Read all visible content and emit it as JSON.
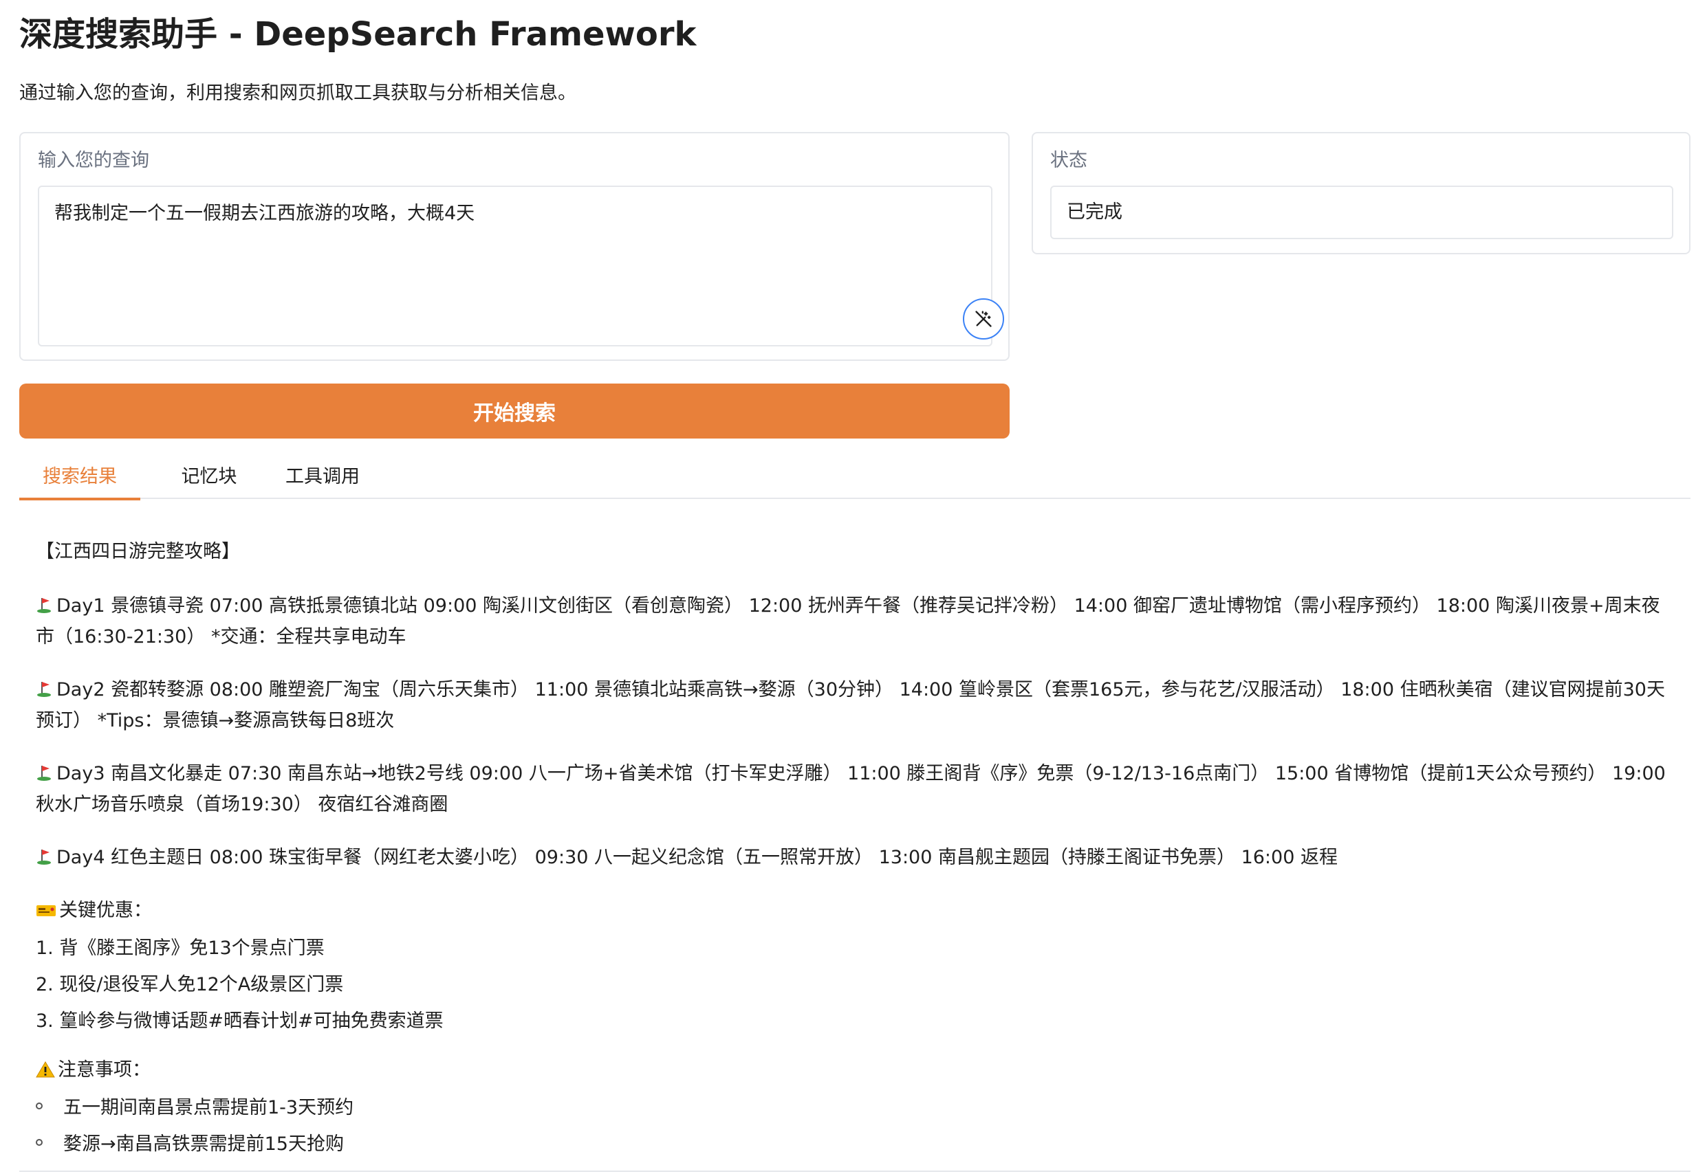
{
  "header": {
    "title": "深度搜索助手 - DeepSearch Framework",
    "subtitle": "通过输入您的查询，利用搜索和网页抓取工具获取与分析相关信息。"
  },
  "query_panel": {
    "label": "输入您的查询",
    "value": "帮我制定一个五一假期去江西旅游的攻略，大概4天",
    "enhance_icon": "magic-wand-icon"
  },
  "status_panel": {
    "label": "状态",
    "value": "已完成"
  },
  "search_button": {
    "label": "开始搜索"
  },
  "tabs": [
    {
      "label": "搜索结果",
      "active": true
    },
    {
      "label": "记忆块",
      "active": false
    },
    {
      "label": "工具调用",
      "active": false
    }
  ],
  "results": {
    "heading": "【江西四日游完整攻略】",
    "days": [
      {
        "icon": "golf-flag-icon",
        "text": "Day1 景德镇寻瓷 07:00 高铁抵景德镇北站 09:00 陶溪川文创街区（看创意陶瓷） 12:00 抚州弄午餐（推荐吴记拌冷粉） 14:00 御窑厂遗址博物馆（需小程序预约） 18:00 陶溪川夜景+周末夜市（16:30-21:30） *交通：全程共享电动车"
      },
      {
        "icon": "golf-flag-icon",
        "text": "Day2 瓷都转婺源 08:00 雕塑瓷厂淘宝（周六乐天集市） 11:00 景德镇北站乘高铁→婺源（30分钟） 14:00 篁岭景区（套票165元，参与花艺/汉服活动） 18:00 住晒秋美宿（建议官网提前30天预订） *Tips：景德镇→婺源高铁每日8班次"
      },
      {
        "icon": "golf-flag-icon",
        "text": "Day3 南昌文化暴走 07:30 南昌东站→地铁2号线 09:00 八一广场+省美术馆（打卡军史浮雕） 11:00 滕王阁背《序》免票（9-12/13-16点南门） 15:00 省博物馆（提前1天公众号预约） 19:00 秋水广场音乐喷泉（首场19:30） 夜宿红谷滩商圈"
      },
      {
        "icon": "golf-flag-icon",
        "text": "Day4 红色主题日 08:00 珠宝街早餐（网红老太婆小吃） 09:30 八一起义纪念馆（五一照常开放） 13:00 南昌舰主题园（持滕王阁证书免票） 16:00 返程"
      }
    ],
    "offers": {
      "icon": "ticket-icon",
      "label": "关键优惠：",
      "items": [
        "1. 背《滕王阁序》免13个景点门票",
        "2. 现役/退役军人免12个A级景区门票",
        "3. 篁岭参与微博话题#晒春计划#可抽免费索道票"
      ]
    },
    "notes": {
      "icon": "warning-icon",
      "label": "注意事项：",
      "items": [
        "五一期间南昌景点需提前1-3天预约",
        "婺源→南昌高铁票需提前15天抢购"
      ]
    }
  },
  "colors": {
    "accent": "#e8803a",
    "border": "#e5e7eb",
    "focus_ring": "#3b82f6",
    "muted_text": "#6b7280"
  }
}
